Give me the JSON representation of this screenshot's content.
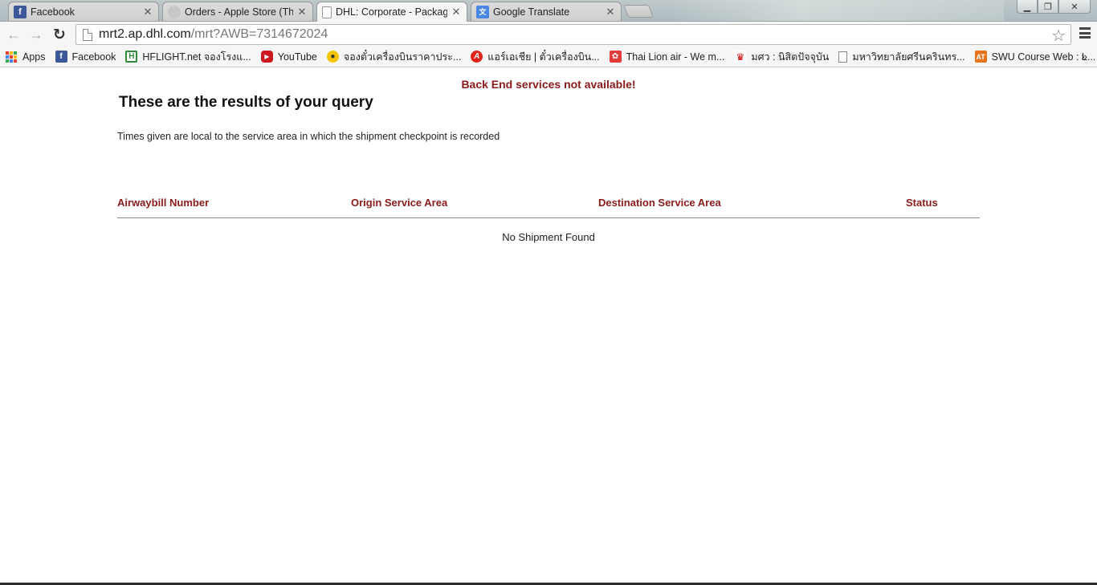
{
  "browser": {
    "tabs": [
      {
        "title": "Facebook",
        "icon": "facebook-icon",
        "active": false
      },
      {
        "title": "Orders - Apple Store (Thai",
        "icon": "apple-icon",
        "active": false
      },
      {
        "title": "DHL: Corporate - Package",
        "icon": "page-icon",
        "active": true
      },
      {
        "title": "Google Translate",
        "icon": "google-translate-icon",
        "active": false
      }
    ],
    "url_host": "mrt2.ap.dhl.com",
    "url_path": "/mrt?AWB=7314672024",
    "bookmarks": [
      {
        "label": "Apps",
        "icon": "apps-grid-icon"
      },
      {
        "label": "Facebook",
        "icon": "facebook-icon"
      },
      {
        "label": "HFLIGHT.net จองโรงแ...",
        "icon": "hflight-icon"
      },
      {
        "label": "YouTube",
        "icon": "youtube-icon"
      },
      {
        "label": "จองตั๋วเครื่องบินราคาประ...",
        "icon": "ticket-icon"
      },
      {
        "label": "แอร์เอเชีย | ตั๋วเครื่องบิน...",
        "icon": "airasia-icon"
      },
      {
        "label": "Thai Lion air - We m...",
        "icon": "thai-lion-air-icon"
      },
      {
        "label": "มศว : นิสิตปัจจุบัน",
        "icon": "swu-icon"
      },
      {
        "label": "มหาวิทยาลัยศรีนครินทร...",
        "icon": "page-icon"
      },
      {
        "label": "SWU Course Web : L...",
        "icon": "swu-course-icon"
      }
    ],
    "bookmarks_more": "»"
  },
  "page": {
    "error": "Back End services not available!",
    "heading": "These are the results of your query",
    "note": "Times given are local to the service area in which the shipment checkpoint is recorded",
    "columns": [
      "Airwaybill Number",
      "Origin Service Area",
      "Destination Service Area",
      "Status"
    ],
    "empty_message": "No Shipment Found"
  },
  "colors": {
    "accent_red": "#8b1a1a"
  }
}
